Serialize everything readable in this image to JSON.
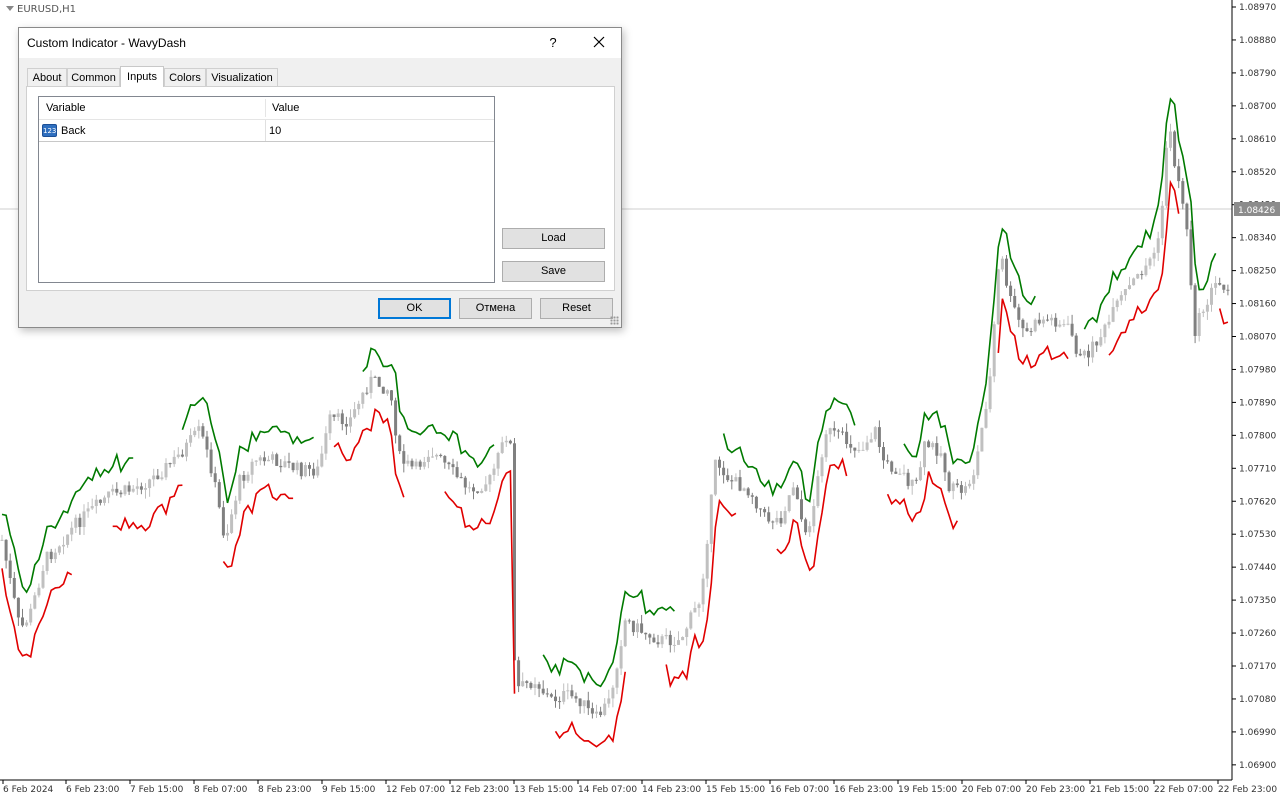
{
  "chart": {
    "symbol_label": "EURUSD,H1",
    "current_price": "1.08426",
    "price_labels": [
      "1.08970",
      "1.08880",
      "1.08790",
      "1.08700",
      "1.08610",
      "1.08520",
      "1.08430",
      "1.08340",
      "1.08250",
      "1.08160",
      "1.08070",
      "1.07980",
      "1.07890",
      "1.07800",
      "1.07710",
      "1.07620",
      "1.07530",
      "1.07440",
      "1.07350",
      "1.07260",
      "1.07170",
      "1.07080",
      "1.06990",
      "1.06900"
    ],
    "time_labels": [
      "6 Feb 2024",
      "6 Feb 23:00",
      "7 Feb 15:00",
      "8 Feb 07:00",
      "8 Feb 23:00",
      "9 Feb 15:00",
      "12 Feb 07:00",
      "12 Feb 23:00",
      "13 Feb 15:00",
      "14 Feb 07:00",
      "14 Feb 23:00",
      "15 Feb 15:00",
      "16 Feb 07:00",
      "16 Feb 23:00",
      "19 Feb 15:00",
      "20 Feb 07:00",
      "20 Feb 23:00",
      "21 Feb 15:00",
      "22 Feb 07:00",
      "22 Feb 23:00"
    ],
    "colors": {
      "up_line": "#007a00",
      "down_line": "#e00000",
      "bull_candle": "#c0c0c0",
      "bear_candle": "#808080",
      "price_line": "#c8c8c8"
    }
  },
  "dialog": {
    "title": "Custom Indicator - WavyDash",
    "help_label": "?",
    "tabs": [
      {
        "label": "About",
        "active": false
      },
      {
        "label": "Common",
        "active": false
      },
      {
        "label": "Inputs",
        "active": true
      },
      {
        "label": "Colors",
        "active": false
      },
      {
        "label": "Visualization",
        "active": false
      }
    ],
    "inputs_table": {
      "headers": {
        "variable": "Variable",
        "value": "Value"
      },
      "rows": [
        {
          "icon": "123",
          "name": "Back",
          "value": "10"
        }
      ]
    },
    "buttons": {
      "load": "Load",
      "save": "Save",
      "ok": "OK",
      "cancel": "Отмена",
      "reset": "Reset"
    }
  }
}
